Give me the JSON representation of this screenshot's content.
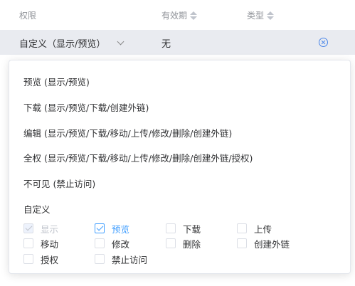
{
  "table": {
    "columns": {
      "permission": "权限",
      "validity": "有效期",
      "type": "类型"
    },
    "row": {
      "permission": "自定义（显示/预览）",
      "validity": "无"
    }
  },
  "dropdown": {
    "options": [
      "预览 (显示/预览)",
      "下载 (显示/预览/下载/创建外链)",
      "编辑 (显示/预览/下载/移动/上传/修改/删除/创建外链)",
      "全权 (显示/预览/下载/移动/上传/修改/删除/创建外链/授权)",
      "不可见 (禁止访问)"
    ],
    "custom_label": "自定义",
    "checkboxes": [
      {
        "label": "显示",
        "checked": true,
        "disabled": true
      },
      {
        "label": "预览",
        "checked": true,
        "disabled": false
      },
      {
        "label": "下载",
        "checked": false,
        "disabled": false
      },
      {
        "label": "上传",
        "checked": false,
        "disabled": false
      },
      {
        "label": "移动",
        "checked": false,
        "disabled": false
      },
      {
        "label": "修改",
        "checked": false,
        "disabled": false
      },
      {
        "label": "删除",
        "checked": false,
        "disabled": false
      },
      {
        "label": "创建外链",
        "checked": false,
        "disabled": false
      },
      {
        "label": "授权",
        "checked": false,
        "disabled": false
      },
      {
        "label": "禁止访问",
        "checked": false,
        "disabled": false
      }
    ]
  },
  "colors": {
    "accent": "#409eff",
    "row_bg": "#e9ebf0",
    "clear_icon": "#4a86e8"
  }
}
